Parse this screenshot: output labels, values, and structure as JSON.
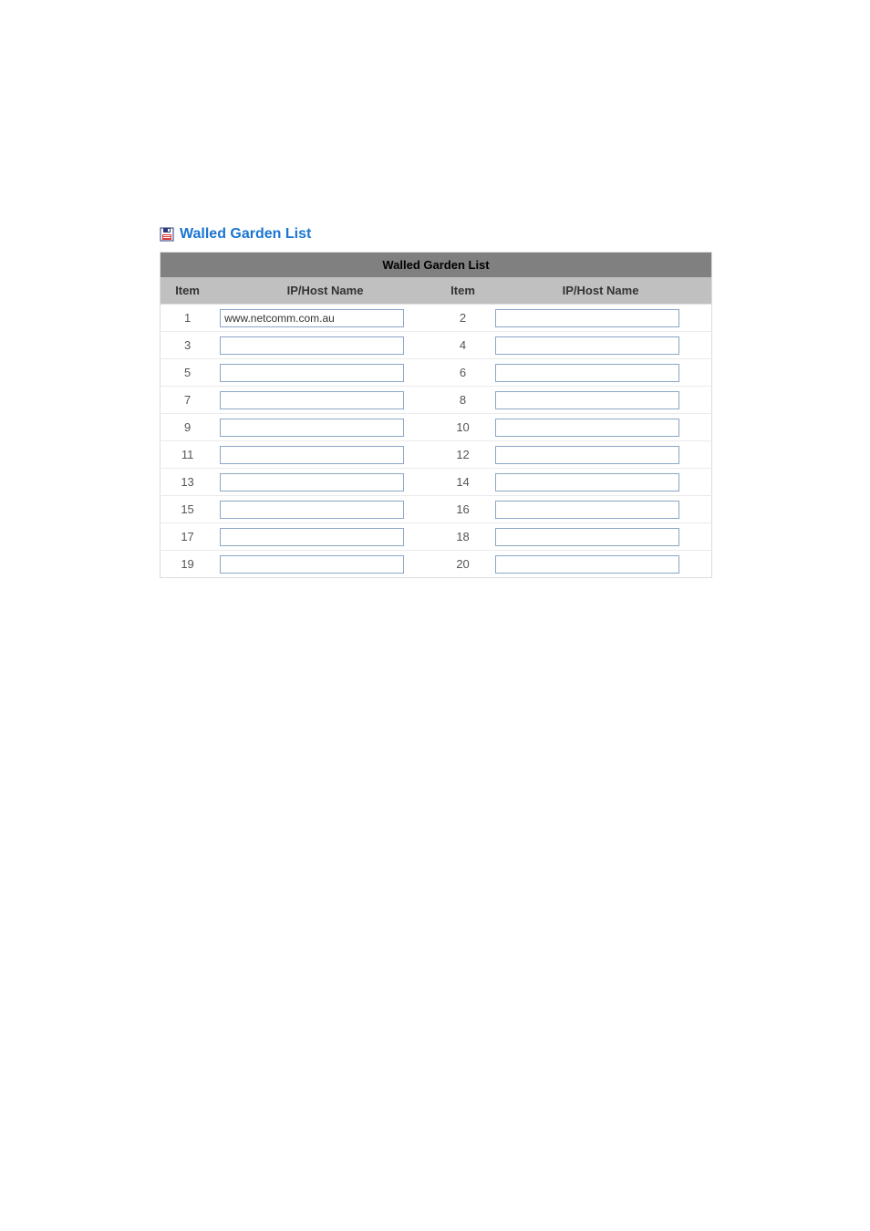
{
  "heading": "Walled Garden List",
  "table": {
    "caption": "Walled Garden List",
    "col_item": "Item",
    "col_host": "IP/Host Name"
  },
  "entries": [
    {
      "n": "1",
      "v": "www.netcomm.com.au"
    },
    {
      "n": "2",
      "v": ""
    },
    {
      "n": "3",
      "v": ""
    },
    {
      "n": "4",
      "v": ""
    },
    {
      "n": "5",
      "v": ""
    },
    {
      "n": "6",
      "v": ""
    },
    {
      "n": "7",
      "v": ""
    },
    {
      "n": "8",
      "v": ""
    },
    {
      "n": "9",
      "v": ""
    },
    {
      "n": "10",
      "v": ""
    },
    {
      "n": "11",
      "v": ""
    },
    {
      "n": "12",
      "v": ""
    },
    {
      "n": "13",
      "v": ""
    },
    {
      "n": "14",
      "v": ""
    },
    {
      "n": "15",
      "v": ""
    },
    {
      "n": "16",
      "v": ""
    },
    {
      "n": "17",
      "v": ""
    },
    {
      "n": "18",
      "v": ""
    },
    {
      "n": "19",
      "v": ""
    },
    {
      "n": "20",
      "v": ""
    }
  ]
}
